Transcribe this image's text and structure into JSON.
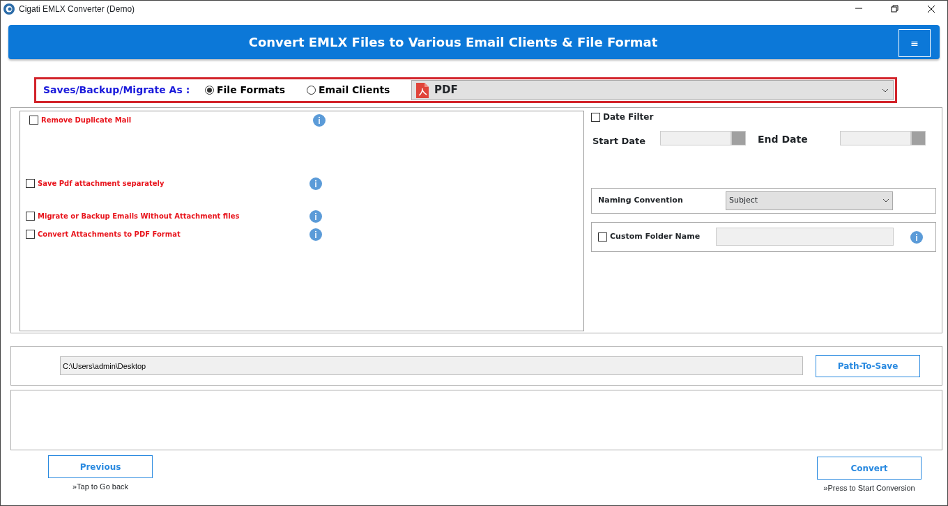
{
  "window": {
    "title": "Cigati EMLX Converter (Demo)"
  },
  "header": {
    "title": "Convert EMLX Files to Various Email Clients & File Format",
    "menu_icon": "≡"
  },
  "save_as": {
    "label": "Saves/Backup/Migrate As :",
    "options": [
      {
        "label": "File Formats",
        "selected": true
      },
      {
        "label": "Email Clients",
        "selected": false
      }
    ],
    "format": "PDF"
  },
  "options": [
    {
      "label": "Remove Duplicate Mail",
      "checked": false
    },
    {
      "label": "Save Pdf attachment separately",
      "checked": false
    },
    {
      "label": "Migrate or Backup Emails Without Attachment files",
      "checked": false
    },
    {
      "label": "Convert Attachments to PDF Format",
      "checked": false
    }
  ],
  "date_filter": {
    "label": "Date Filter",
    "checked": false,
    "start_label": "Start Date",
    "end_label": "End Date"
  },
  "naming_convention": {
    "label": "Naming Convention",
    "value": "Subject"
  },
  "custom_folder": {
    "label": "Custom Folder Name",
    "checked": false
  },
  "path": {
    "value": "C:\\Users\\admin\\Desktop",
    "button": "Path-To-Save"
  },
  "previous": {
    "label": "Previous",
    "hint": "»Tap to Go back"
  },
  "convert": {
    "label": "Convert",
    "hint": "»Press to Start Conversion"
  }
}
